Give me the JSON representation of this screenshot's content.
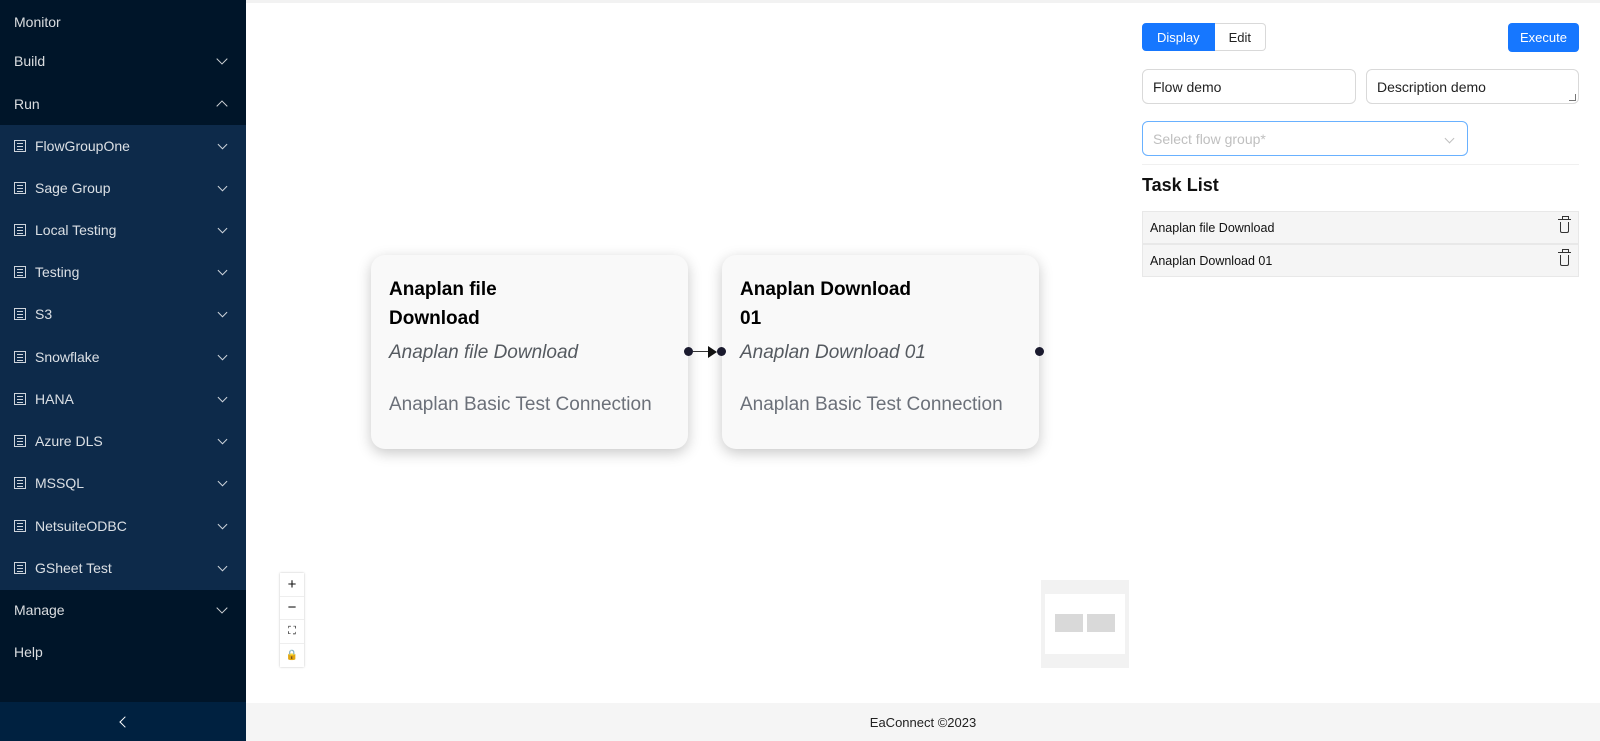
{
  "sidebar": {
    "monitor": "Monitor",
    "build": "Build",
    "run": "Run",
    "groups": [
      "FlowGroupOne",
      "Sage Group",
      "Local Testing",
      "Testing",
      "S3",
      "Snowflake",
      "HANA",
      "Azure DLS",
      "MSSQL",
      "NetsuiteODBC",
      "GSheet Test"
    ],
    "manage": "Manage",
    "help": "Help",
    "collapse_icon": "chevron-left-icon"
  },
  "canvas": {
    "nodes": [
      {
        "title": "Anaplan file Download",
        "subtitle": "Anaplan file Download",
        "connection": "Anaplan Basic Test Connection"
      },
      {
        "title": "Anaplan Download 01",
        "subtitle": "Anaplan Download 01",
        "connection": "Anaplan Basic Test Connection"
      }
    ],
    "controls": {
      "zoom_in": "+",
      "zoom_out": "−",
      "fit": "⛶",
      "lock": "🔒"
    }
  },
  "panel": {
    "display_label": "Display",
    "edit_label": "Edit",
    "execute_label": "Execute",
    "flow_name": "Flow demo",
    "description": "Description demo",
    "flow_group_placeholder": "Select flow group*",
    "task_list_title": "Task List",
    "tasks": [
      "Anaplan file Download",
      "Anaplan Download 01"
    ]
  },
  "footer": {
    "text": "EaConnect ©2023"
  },
  "colors": {
    "sidebar_bg": "#001529",
    "submenu_bg": "#0d2a4a",
    "primary": "#1677ff"
  }
}
